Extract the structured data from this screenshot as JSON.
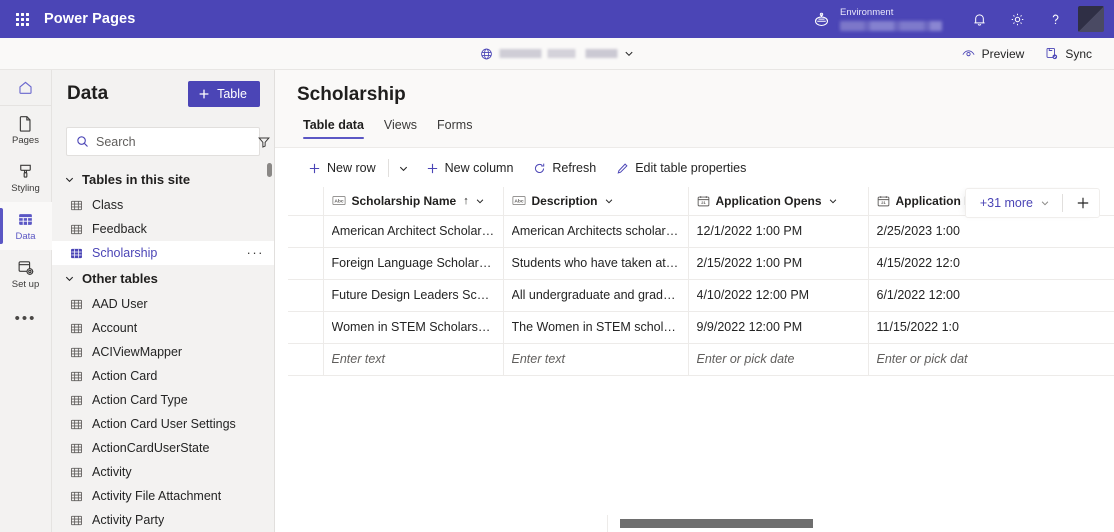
{
  "topbar": {
    "waffle_icon": "waffle-grid-icon",
    "app_title": "Power Pages",
    "globe_icon": "environment-globe-icon",
    "environment_label": "Environment",
    "environment_value": "",
    "notifications_icon": "bell-icon",
    "settings_icon": "gear-icon",
    "help_icon": "question-mark-icon",
    "avatar": "user-avatar",
    "brand_color": "#4b45b6"
  },
  "sitebar": {
    "site_icon": "globe-icon",
    "site_name": "",
    "site_caret": "chevron-down-icon",
    "preview_label": "Preview",
    "preview_icon": "preview-eye-icon",
    "sync_label": "Sync",
    "sync_icon": "sync-icon"
  },
  "rail": {
    "home_icon": "home-icon",
    "items": [
      {
        "label": "Pages",
        "icon": "page-icon",
        "active": false
      },
      {
        "label": "Styling",
        "icon": "paint-brush-icon",
        "active": false
      },
      {
        "label": "Data",
        "icon": "data-table-icon",
        "active": true
      },
      {
        "label": "Set up",
        "icon": "setup-gear-icon",
        "active": false
      }
    ],
    "more_label": "•••"
  },
  "sidebar": {
    "title": "Data",
    "new_table_label": "Table",
    "new_table_icon": "plus-icon",
    "search_placeholder": "Search",
    "search_value": "",
    "search_icon": "search-icon",
    "filter_icon": "filter-icon",
    "groups": [
      {
        "label": "Tables in this site",
        "expanded": true,
        "chevron": "chevron-down-icon",
        "items": [
          {
            "label": "Class",
            "icon": "table-icon",
            "selected": false
          },
          {
            "label": "Feedback",
            "icon": "table-icon",
            "selected": false
          },
          {
            "label": "Scholarship",
            "icon": "table-icon",
            "selected": true,
            "overflow": "···"
          }
        ]
      },
      {
        "label": "Other tables",
        "expanded": true,
        "chevron": "chevron-down-icon",
        "items": [
          {
            "label": "AAD User",
            "icon": "table-icon",
            "selected": false
          },
          {
            "label": "Account",
            "icon": "table-icon",
            "selected": false
          },
          {
            "label": "ACIViewMapper",
            "icon": "table-icon",
            "selected": false
          },
          {
            "label": "Action Card",
            "icon": "table-icon",
            "selected": false
          },
          {
            "label": "Action Card Type",
            "icon": "table-icon",
            "selected": false
          },
          {
            "label": "Action Card User Settings",
            "icon": "table-icon",
            "selected": false
          },
          {
            "label": "ActionCardUserState",
            "icon": "table-icon",
            "selected": false
          },
          {
            "label": "Activity",
            "icon": "table-icon",
            "selected": false
          },
          {
            "label": "Activity File Attachment",
            "icon": "table-icon",
            "selected": false
          },
          {
            "label": "Activity Party",
            "icon": "table-icon",
            "selected": false
          }
        ]
      }
    ]
  },
  "main": {
    "page_title": "Scholarship",
    "tabs": [
      {
        "label": "Table data",
        "active": true
      },
      {
        "label": "Views",
        "active": false
      },
      {
        "label": "Forms",
        "active": false
      }
    ],
    "commands": [
      {
        "label": "New row",
        "icon": "plus-icon",
        "has_caret": true
      },
      {
        "label": "New column",
        "icon": "plus-icon",
        "has_caret": false
      },
      {
        "label": "Refresh",
        "icon": "refresh-icon",
        "has_caret": false
      },
      {
        "label": "Edit table properties",
        "icon": "pencil-icon",
        "has_caret": false
      }
    ],
    "grid": {
      "columns": [
        {
          "label": "Scholarship Name",
          "type_icon": "abc-text-icon",
          "sorted": "ascending",
          "sort_glyph": "↑",
          "caret": "chevron-down-icon"
        },
        {
          "label": "Description",
          "type_icon": "abc-text-icon",
          "sorted": "",
          "sort_glyph": "",
          "caret": "chevron-down-icon"
        },
        {
          "label": "Application Opens",
          "type_icon": "calendar-icon",
          "sorted": "",
          "sort_glyph": "",
          "caret": "chevron-down-icon"
        },
        {
          "label": "Application D",
          "type_icon": "calendar-icon",
          "sorted": "",
          "sort_glyph": "",
          "caret": "chevron-down-icon"
        }
      ],
      "rows": [
        {
          "name": "American Architect Scholarship",
          "description": "American Architects scholarship is...",
          "opens": "12/1/2022 1:00 PM",
          "deadline": "2/25/2023 1:00"
        },
        {
          "name": "Foreign Language Scholarship",
          "description": "Students who have taken at least ...",
          "opens": "2/15/2022 1:00 PM",
          "deadline": "4/15/2022 12:0"
        },
        {
          "name": "Future Design Leaders Scholarship",
          "description": "All undergraduate and graduate s...",
          "opens": "4/10/2022 12:00 PM",
          "deadline": "6/1/2022 12:00"
        },
        {
          "name": "Women in STEM Scholarship",
          "description": "The Women in STEM scholarship i...",
          "opens": "9/9/2022 12:00 PM",
          "deadline": "11/15/2022 1:0"
        }
      ],
      "new_row": {
        "name_placeholder": "Enter text",
        "description_placeholder": "Enter text",
        "opens_placeholder": "Enter or pick date",
        "deadline_placeholder": "Enter or pick dat"
      },
      "more_columns_label": "+31 more",
      "more_columns_caret": "chevron-down-icon",
      "add_column_icon": "plus-icon"
    }
  }
}
